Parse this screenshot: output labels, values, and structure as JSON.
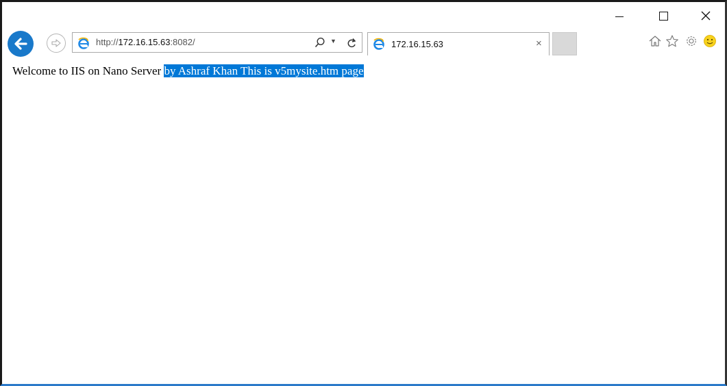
{
  "window": {
    "controls": {
      "minimize": "minimize",
      "maximize": "maximize",
      "close": "close"
    }
  },
  "nav": {
    "back_icon": "back-arrow-icon",
    "forward_icon": "forward-arrow-icon"
  },
  "address_bar": {
    "scheme": "http://",
    "host": "172.16.15.63",
    "port_path": ":8082/",
    "search_icon": "search-icon",
    "refresh_icon": "refresh-icon"
  },
  "tab": {
    "title": "172.16.15.63",
    "close_glyph": "×"
  },
  "toolbar": {
    "icons": [
      "home-icon",
      "favorites-star-icon",
      "settings-gear-icon",
      "feedback-smiley-icon"
    ]
  },
  "page": {
    "text_plain": "Welcome to IIS on Nano Server ",
    "text_selected": "by Ashraf Khan This is v5mysite.htm page"
  },
  "colors": {
    "back_button": "#1979ca",
    "selection": "#0078d7",
    "ie_logo": "#1e88e5"
  }
}
